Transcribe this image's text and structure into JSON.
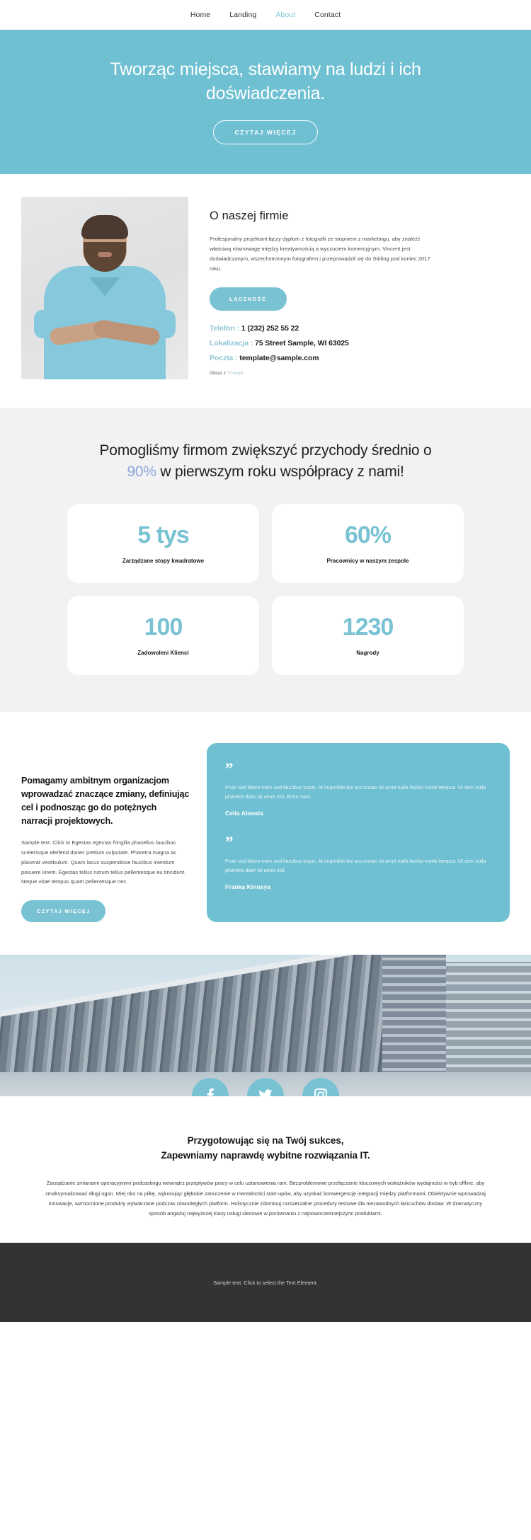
{
  "nav": {
    "items": [
      {
        "label": "Home",
        "active": false
      },
      {
        "label": "Landing",
        "active": false
      },
      {
        "label": "About",
        "active": true
      },
      {
        "label": "Contact",
        "active": false
      }
    ]
  },
  "hero": {
    "heading": "Tworząc miejsca, stawiamy na ludzi i ich doświadczenia.",
    "button": "CZYTAJ WIĘCEJ",
    "background_color": "#6fc0d2"
  },
  "about": {
    "photo_alt": "bearded-man-portrait",
    "title": "O naszej firmie",
    "paragraph": "Profesjonalny projektant łączy dyplom z fotografii ze stopniem z marketingu, aby znaleźć właściwą równowagę między kreatywnością a wyczuciem komercyjnym. Vincent jest doświadczonym, wszechstronnym fotografem i przeprowadził się do Stirling pod koniec 2017 roku.",
    "button": "ŁĄCZNOŚĆ",
    "contacts": [
      {
        "key": "Telefon :",
        "value": "1 (232) 252 55 22"
      },
      {
        "key": "Lokalizacja :",
        "value": "75 Street Sample, WI 63025"
      },
      {
        "key": "Poczta :",
        "value": "template@sample.com"
      }
    ],
    "credit_prefix": "Obraz z",
    "credit_source": "Freepik",
    "accent_color": "#79c2d3"
  },
  "stats": {
    "heading_part1": "Pomogliśmy firmom zwiększyć przychody średnio o ",
    "heading_highlight": "90%",
    "heading_part2": " w pierwszym roku współpracy z nami!",
    "highlight_color": "#8fa7e0",
    "cards": [
      {
        "number": "5 tys",
        "label": "Zarządzane stopy kwadratowe"
      },
      {
        "number": "60%",
        "label": "Pracownicy w naszym zespole"
      },
      {
        "number": "100",
        "label": "Zadowoleni Klienci"
      },
      {
        "number": "1230",
        "label": "Nagrody"
      }
    ]
  },
  "testimonials": {
    "heading": "Pomagamy ambitnym organizacjom wprowadzać znaczące zmiany, definiując cel i podnosząc go do potężnych narracji projektowych.",
    "paragraph": "Sample text. Click to Egestas egestas fringilla phasellus faucibus scelerisque eleifend donec pretium vulputate. Pharetra magna ac placerat vestibulum. Quam lacus suspendisse faucibus interdum posuere lorem. Egestas tellus rutrum tellus pellentesque eu tincidunt. Neque vitae tempus quam pellentesque nec.",
    "button": "CZYTAJ WIĘCEJ",
    "quote_glyph": "”",
    "items": [
      {
        "text": "Proin sed libero enim sed faucibus turpis. At imperdiet dui accumsan sit amet nulla facilisi morbi tempus. Ut sem nulla pharetra diam sit amet nisl. Enim nunc",
        "author": "Celia Almeda"
      },
      {
        "text": "Proin sed libero enim sed faucibus turpis. At imperdiet dui accumsan sit amet nulla facilisi morbi tempus. Ut sem nulla pharetra diam sit amet nisl.",
        "author": "Franka Kinneya"
      }
    ],
    "card_color": "#6fc0d2"
  },
  "social": {
    "items": [
      {
        "name": "facebook-icon",
        "label": "Facebook"
      },
      {
        "name": "twitter-icon",
        "label": "Twitter"
      },
      {
        "name": "instagram-icon",
        "label": "Instagram"
      }
    ],
    "circle_color": "#79c2d3"
  },
  "closing": {
    "heading_line1": "Przygotowując się na Twój sukces,",
    "heading_line2": "Zapewniamy naprawdę wybitne rozwiązania IT.",
    "paragraph": "Zarządzanie zmianami operacyjnymi podcastingu wewnątrz przepływów pracy w celu ustanowienia ram. Bezproblemowe przełączanie kluczowych wskaźników wydajności w tryb offline, aby zmaksymalizować długi ogon. Miej oko na piłkę, wykonując głębokie zanurzenie w mentalności start-upów, aby uzyskać konwergencję integracji między platformami. Obiektywnie wprowadzaj innowacje, wzmocnione produkty wytwarzane podczas równoległych platform. Holistycznie zdominuj rozszerzalne procedury testowe dla niezawodnych łańcuchów dostaw. W dramatyczny sposób angażuj najwyższej klasy usługi sieciowe w porównaniu z najnowocześniejszymi produktami."
  },
  "footer": {
    "text": "Sample text. Click to select the Text Element.",
    "background_color": "#333333"
  }
}
